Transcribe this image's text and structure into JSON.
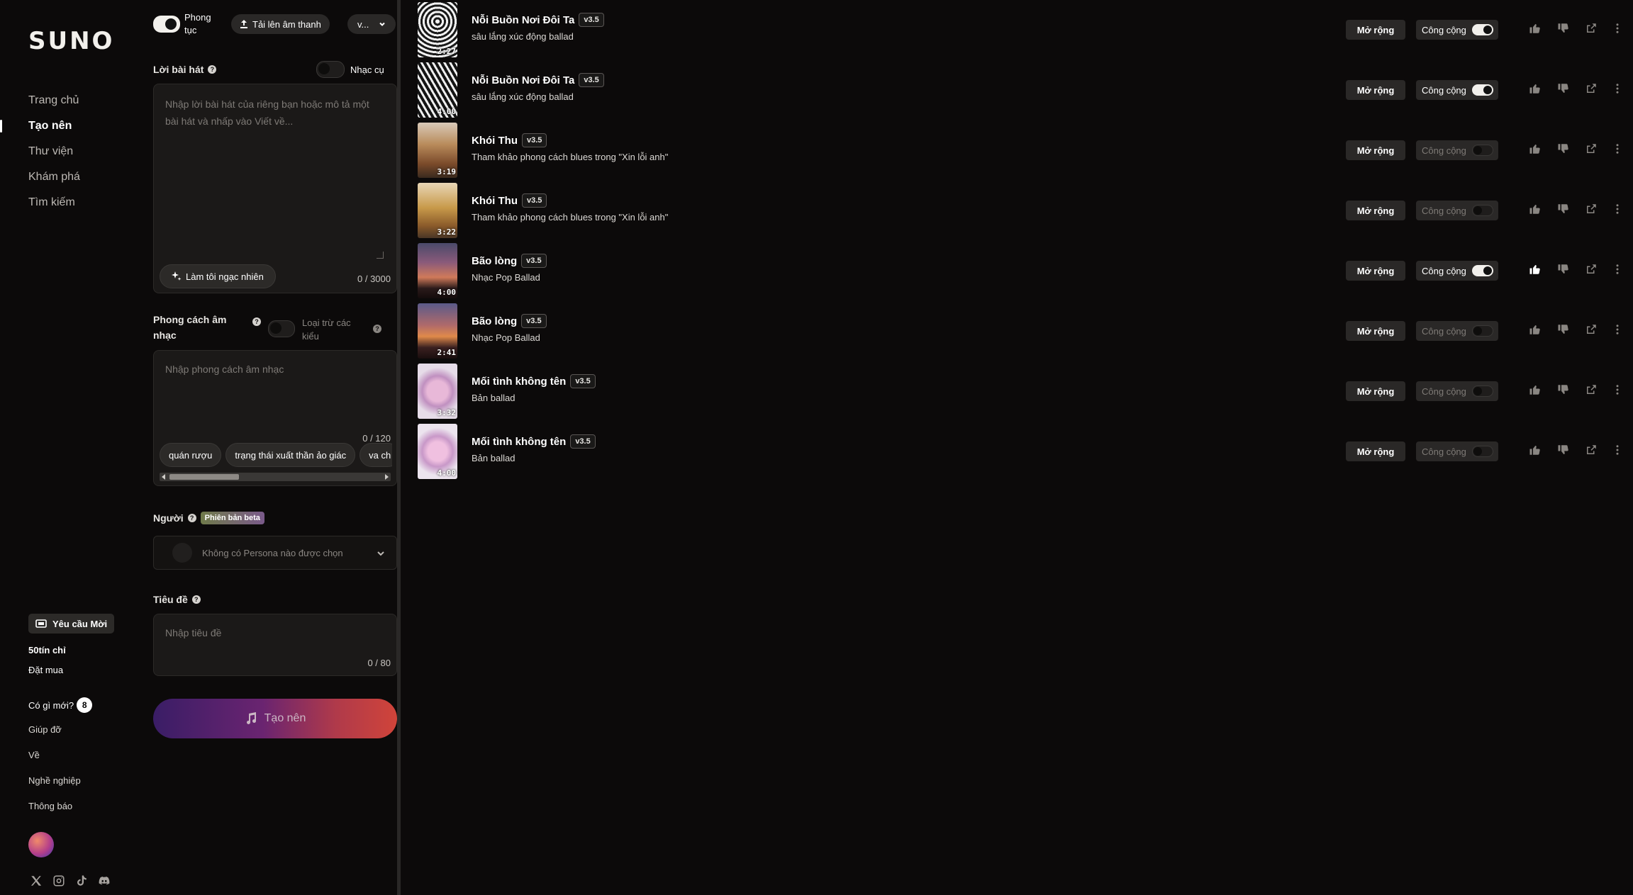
{
  "app": {
    "logo": "SUNO"
  },
  "sidebar": {
    "nav": [
      {
        "label": "Trang chủ",
        "active": false
      },
      {
        "label": "Tạo nên",
        "active": true
      },
      {
        "label": "Thư viện",
        "active": false
      },
      {
        "label": "Khám phá",
        "active": false
      },
      {
        "label": "Tìm kiếm",
        "active": false
      }
    ],
    "invite_label": "Yêu cầu Mời",
    "credits": "50tín chỉ",
    "subscribe": "Đặt mua",
    "whats_new": "Có gì mới?",
    "whats_new_count": "8",
    "links": [
      "Giúp đỡ",
      "Về",
      "Nghề nghiệp",
      "Thông báo"
    ],
    "social_icons": [
      "x-icon",
      "instagram-icon",
      "tiktok-icon",
      "discord-icon"
    ]
  },
  "create": {
    "custom_label": "Phong tục",
    "custom_on": true,
    "upload_label": "Tải lên âm thanh",
    "version_value": "v...",
    "lyrics": {
      "label": "Lời bài hát",
      "instrumental_label": "Nhạc cụ",
      "placeholder": "Nhập lời bài hát của riêng bạn hoặc mô tả một bài hát và nhấp vào Viết về...",
      "surprise_label": "Làm tôi ngạc nhiên",
      "counter": "0 / 3000"
    },
    "style": {
      "label": "Phong cách âm nhạc",
      "exclude_label": "Loại trừ các kiểu",
      "placeholder": "Nhập phong cách âm nhạc",
      "counter": "0 / 120",
      "chips": [
        "quán rượu",
        "trạng thái xuất thần ảo giác",
        "va ch"
      ]
    },
    "persona": {
      "label": "Người",
      "beta": "Phiên bản beta",
      "value": "Không có Persona nào được chọn"
    },
    "title": {
      "label": "Tiêu đề",
      "placeholder": "Nhập tiêu đề",
      "counter": "0 / 80"
    },
    "create_label": "Tạo nên"
  },
  "song_actions": {
    "extend": "Mở rộng",
    "public": "Công cộng"
  },
  "songs": [
    {
      "title": "Nỗi Buồn Nơi Đôi Ta",
      "version": "v3.5",
      "desc": "sâu lắng xúc động ballad",
      "duration": "2:27",
      "public": true,
      "liked": false,
      "art": "zebra1"
    },
    {
      "title": "Nỗi Buồn Nơi Đôi Ta",
      "version": "v3.5",
      "desc": "sâu lắng xúc động ballad",
      "duration": "4:00",
      "public": true,
      "liked": false,
      "art": "zebra2"
    },
    {
      "title": "Khói Thu",
      "version": "v3.5",
      "desc": "Tham khảo phong cách blues trong \"Xin lỗi anh\"",
      "duration": "3:19",
      "public": false,
      "liked": false,
      "art": "autumn1"
    },
    {
      "title": "Khói Thu",
      "version": "v3.5",
      "desc": "Tham khảo phong cách blues trong \"Xin lỗi anh\"",
      "duration": "3:22",
      "public": false,
      "liked": false,
      "art": "autumn2"
    },
    {
      "title": "Bão lòng",
      "version": "v3.5",
      "desc": "Nhạc Pop Ballad",
      "duration": "4:00",
      "public": true,
      "liked": true,
      "art": "sunset1"
    },
    {
      "title": "Bão lòng",
      "version": "v3.5",
      "desc": "Nhạc Pop Ballad",
      "duration": "2:41",
      "public": false,
      "liked": false,
      "art": "sunset2"
    },
    {
      "title": "Mối tình không tên",
      "version": "v3.5",
      "desc": "Bản ballad",
      "duration": "3:32",
      "public": false,
      "liked": false,
      "art": "heart1"
    },
    {
      "title": "Mối tình không tên",
      "version": "v3.5",
      "desc": "Bản ballad",
      "duration": "4:00",
      "public": false,
      "liked": false,
      "art": "heart2"
    }
  ],
  "colors": {
    "bg": "#0c0a0a",
    "panel_input": "#1b1918",
    "button": "#2a2827",
    "accent_gradient_start": "#3a1d66",
    "accent_gradient_end": "#d0443a"
  }
}
